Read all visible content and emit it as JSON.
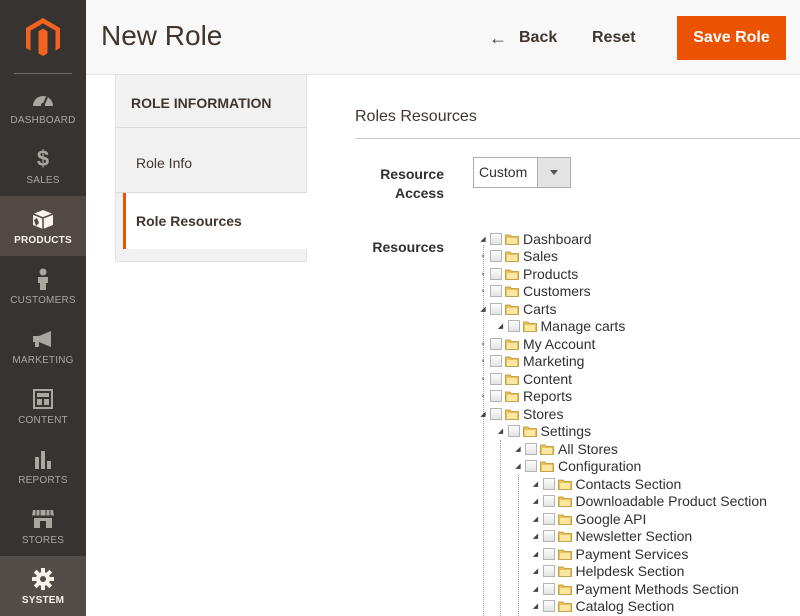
{
  "sidebar": {
    "items": [
      {
        "label": "DASHBOARD",
        "icon": "dashboard-icon"
      },
      {
        "label": "SALES",
        "icon": "dollar-icon"
      },
      {
        "label": "PRODUCTS",
        "icon": "box-icon"
      },
      {
        "label": "CUSTOMERS",
        "icon": "person-icon"
      },
      {
        "label": "MARKETING",
        "icon": "megaphone-icon"
      },
      {
        "label": "CONTENT",
        "icon": "layout-icon"
      },
      {
        "label": "REPORTS",
        "icon": "bar-chart-icon"
      },
      {
        "label": "STORES",
        "icon": "storefront-icon"
      },
      {
        "label": "SYSTEM",
        "icon": "gear-icon"
      }
    ]
  },
  "header": {
    "title": "New Role",
    "back_label": "Back",
    "reset_label": "Reset",
    "save_label": "Save Role"
  },
  "tabs": {
    "heading": "ROLE INFORMATION",
    "items": [
      {
        "label": "Role Info"
      },
      {
        "label": "Role Resources"
      }
    ]
  },
  "main": {
    "section_title": "Roles Resources",
    "resource_access_label_1": "Resource",
    "resource_access_label_2": "Access",
    "resource_access_value": "Custom",
    "resources_label": "Resources"
  },
  "tree": [
    {
      "label": "Dashboard"
    },
    {
      "label": "Sales"
    },
    {
      "label": "Products"
    },
    {
      "label": "Customers"
    },
    {
      "label": "Carts"
    },
    {
      "label": "Manage carts"
    },
    {
      "label": "My Account"
    },
    {
      "label": "Marketing"
    },
    {
      "label": "Content"
    },
    {
      "label": "Reports"
    },
    {
      "label": "Stores"
    },
    {
      "label": "Settings"
    },
    {
      "label": "All Stores"
    },
    {
      "label": "Configuration"
    },
    {
      "label": "Contacts Section"
    },
    {
      "label": "Downloadable Product Section"
    },
    {
      "label": "Google API"
    },
    {
      "label": "Newsletter Section"
    },
    {
      "label": "Payment Services"
    },
    {
      "label": "Helpdesk Section"
    },
    {
      "label": "Payment Methods Section"
    },
    {
      "label": "Catalog Section"
    }
  ],
  "colors": {
    "accent": "#eb5202",
    "sidebar_bg": "#373330",
    "folder": "#e8c15a"
  }
}
